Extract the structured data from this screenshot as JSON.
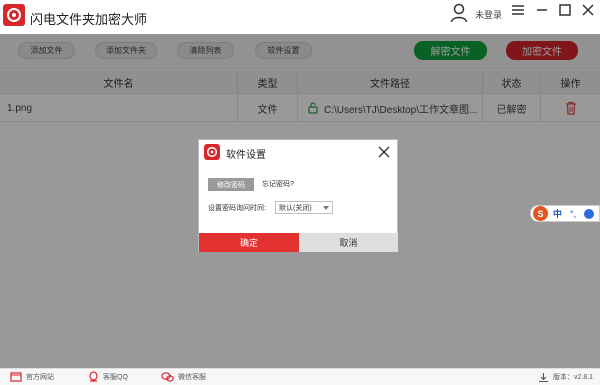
{
  "window": {
    "title": "闪电文件夹加密大师",
    "login_text": "未登录"
  },
  "toolbar": {
    "add_file": "添加文件",
    "add_folder": "添加文件夹",
    "clear_list": "清除列表",
    "settings": "软件设置",
    "decrypt_file": "解密文件",
    "encrypt_file": "加密文件"
  },
  "table": {
    "headers": [
      "文件名",
      "类型",
      "文件路径",
      "状态",
      "操作"
    ],
    "rows": [
      {
        "name": "1.png",
        "type": "文件",
        "path": "C:\\Users\\TJ\\Desktop\\工作文章图...",
        "status": "已解密"
      }
    ]
  },
  "dialog": {
    "title": "软件设置",
    "change_password": "修改密码",
    "forgot_password": "忘记密码?",
    "interval_label": "设置密码询问时间:",
    "interval_value": "默认(关闭)",
    "ok": "确定",
    "cancel": "取消"
  },
  "ime": {
    "logo": "S",
    "lang": "中",
    "punct": "°,"
  },
  "footer": {
    "website": "官方网站",
    "qq": "客服QQ",
    "wechat": "微信客服",
    "version": "版本：v2.8.1"
  },
  "colors": {
    "brand_red": "#d8262c",
    "green": "#11a23f",
    "ok_red": "#e2322f"
  }
}
